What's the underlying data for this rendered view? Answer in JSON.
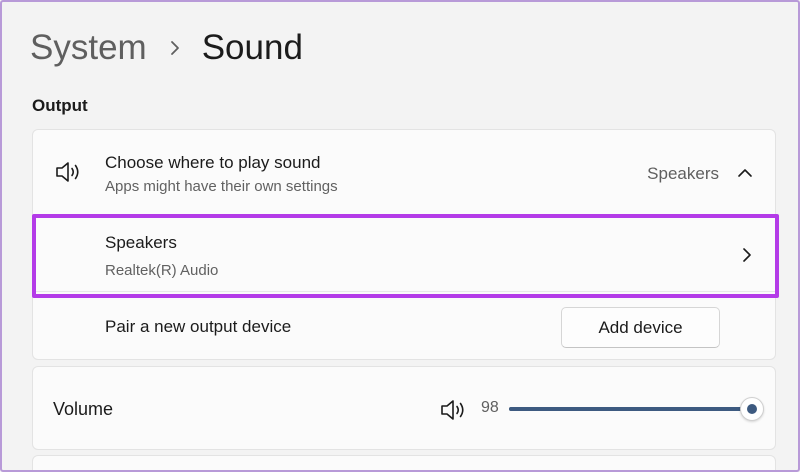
{
  "breadcrumb": {
    "parent": "System",
    "separator": "chevron-right-icon",
    "current": "Sound"
  },
  "output": {
    "section_label": "Output",
    "choose": {
      "icon": "speaker-icon",
      "title": "Choose where to play sound",
      "subtitle": "Apps might have their own settings",
      "value": "Speakers",
      "expand_icon": "chevron-up-icon"
    },
    "device": {
      "name": "Speakers",
      "driver": "Realtek(R) Audio",
      "highlighted": true,
      "open_icon": "chevron-right-icon"
    },
    "pair": {
      "label": "Pair a new output device",
      "button_label": "Add device"
    }
  },
  "volume": {
    "label": "Volume",
    "icon": "speaker-icon",
    "value": 98,
    "value_text": "98"
  },
  "colors": {
    "accent": "#3d5a80",
    "highlight": "#b43be8",
    "background": "#f3f3f3",
    "card": "#fbfbfb"
  }
}
